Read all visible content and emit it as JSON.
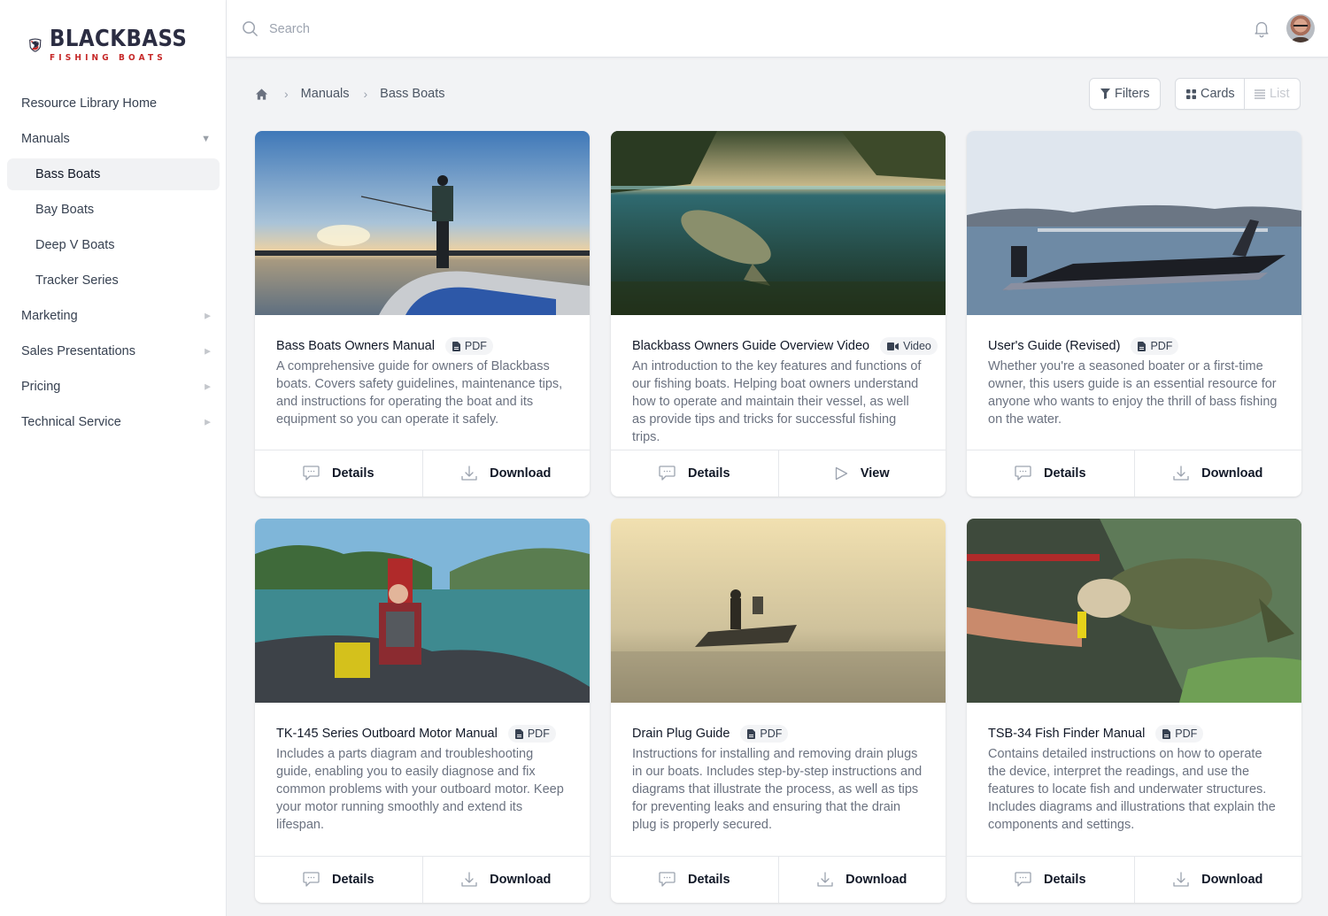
{
  "brand": {
    "name": "BLACKBASS",
    "tagline": "FISHING BOATS",
    "primary_color": "#2b2d42",
    "accent_color": "#c62828"
  },
  "sidebar": {
    "items": [
      {
        "label": "Resource Library Home",
        "level": 0,
        "caret": "none"
      },
      {
        "label": "Manuals",
        "level": 0,
        "caret": "open"
      },
      {
        "label": "Bass Boats",
        "level": 1,
        "active": true
      },
      {
        "label": "Bay Boats",
        "level": 1
      },
      {
        "label": "Deep V Boats",
        "level": 1
      },
      {
        "label": "Tracker Series",
        "level": 1
      },
      {
        "label": "Marketing",
        "level": 0,
        "caret": "closed"
      },
      {
        "label": "Sales Presentations",
        "level": 0,
        "caret": "closed"
      },
      {
        "label": "Pricing",
        "level": 0,
        "caret": "closed"
      },
      {
        "label": "Technical Service",
        "level": 0,
        "caret": "closed"
      }
    ],
    "caret_open_glyph": "▼",
    "caret_closed_glyph": "▶"
  },
  "topbar": {
    "search_placeholder": "Search",
    "search_value": "",
    "notifications_icon": "bell-icon",
    "user_avatar": "user-avatar"
  },
  "breadcrumb": {
    "home_icon": "home-icon",
    "separator": ">",
    "items": [
      "Manuals",
      "Bass Boats"
    ]
  },
  "toolbar": {
    "filters_label": "Filters",
    "view_cards_label": "Cards",
    "view_list_label": "List",
    "active_view": "Cards"
  },
  "cards": [
    {
      "title": "Bass Boats Owners Manual",
      "type": "PDF",
      "type_icon": "document-icon",
      "description": "A comprehensive guide for owners of Blackbass boats. Covers safety guidelines, maintenance tips, and instructions for operating the boat and its equipment so you can operate it safely.",
      "image": "angler casting from boat bow at sunset",
      "actions": [
        {
          "label": "Details",
          "icon": "chat-bubble-icon"
        },
        {
          "label": "Download",
          "icon": "download-icon"
        }
      ]
    },
    {
      "title": "Blackbass Owners Guide Overview Video",
      "type": "Video",
      "type_icon": "video-camera-icon",
      "description": "An introduction to the key features and functions of our fishing boats. Helping boat owners understand how to operate and maintain their vessel, as well as provide tips and tricks for successful fishing trips.",
      "image": "split underwater view of trout in lake",
      "actions": [
        {
          "label": "Details",
          "icon": "chat-bubble-icon"
        },
        {
          "label": "View",
          "icon": "play-icon"
        }
      ]
    },
    {
      "title": "User's Guide (Revised)",
      "type": "PDF",
      "type_icon": "document-icon",
      "description": "Whether you're a seasoned boater or a first-time owner, this users guide is an essential resource for anyone who wants to enjoy the thrill of bass fishing on the water.",
      "image": "bass boat on lake with city skyline",
      "actions": [
        {
          "label": "Details",
          "icon": "chat-bubble-icon"
        },
        {
          "label": "Download",
          "icon": "download-icon"
        }
      ]
    },
    {
      "title": "TK-145 Series Outboard Motor Manual",
      "type": "PDF",
      "type_icon": "document-icon",
      "description": "Includes a parts diagram and troubleshooting guide, enabling you to easily diagnose and fix common problems with your outboard motor. Keep your motor running smoothly and extend its lifespan.",
      "image": "two men riding in inflatable boat",
      "actions": [
        {
          "label": "Details",
          "icon": "chat-bubble-icon"
        },
        {
          "label": "Download",
          "icon": "download-icon"
        }
      ]
    },
    {
      "title": "Drain Plug Guide",
      "type": "PDF",
      "type_icon": "document-icon",
      "description": "Instructions for installing and removing drain plugs in our boats. Includes step-by-step instructions and diagrams that illustrate the process, as well as tips for preventing leaks and ensuring that the drain plug is properly secured.",
      "image": "boat silhouette in morning fog",
      "actions": [
        {
          "label": "Details",
          "icon": "chat-bubble-icon"
        },
        {
          "label": "Download",
          "icon": "download-icon"
        }
      ]
    },
    {
      "title": "TSB-34 Fish Finder Manual",
      "type": "PDF",
      "type_icon": "document-icon",
      "description": "Contains detailed instructions on how to operate the device, interpret the readings, and use the features to locate fish and underwater structures. Includes diagrams and illustrations that explain the components and settings.",
      "image": "hand holding largemouth bass with lure",
      "actions": [
        {
          "label": "Details",
          "icon": "chat-bubble-icon"
        },
        {
          "label": "Download",
          "icon": "download-icon"
        }
      ]
    }
  ]
}
